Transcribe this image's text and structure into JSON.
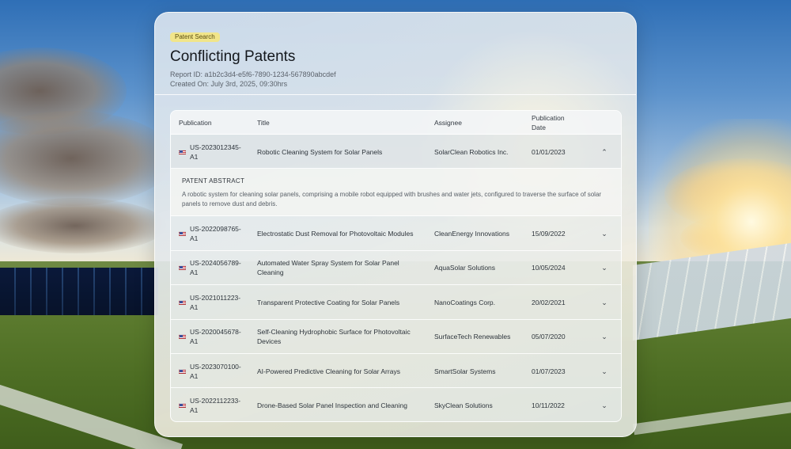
{
  "header": {
    "badge": "Patent Search",
    "title": "Conflicting Patents",
    "report_id": "Report ID: a1b2c3d4-e5f6-7890-1234-567890abcdef",
    "created_on": "Created On: July 3rd, 2025, 09:30hrs"
  },
  "table": {
    "columns": [
      "Publication",
      "Title",
      "Assignee",
      "Publication Date"
    ],
    "abstract_label": "PATENT ABSTRACT",
    "rows": [
      {
        "publication": "US-2023012345-A1",
        "title": "Robotic Cleaning System for Solar Panels",
        "assignee": "SolarClean Robotics Inc.",
        "date": "01/01/2023",
        "chevron": "⌃",
        "abstract": "A robotic system for cleaning solar panels, comprising a mobile robot equipped with brushes and water jets, configured to traverse the surface of solar panels to remove dust and debris."
      },
      {
        "publication": "US-2022098765-A1",
        "title": "Electrostatic Dust Removal for Photovoltaic Modules",
        "assignee": "CleanEnergy Innovations",
        "date": "15/09/2022",
        "chevron": "⌄"
      },
      {
        "publication": "US-2024056789-A1",
        "title": "Automated Water Spray System for Solar Panel Cleaning",
        "assignee": "AquaSolar Solutions",
        "date": "10/05/2024",
        "chevron": "⌄"
      },
      {
        "publication": "US-2021011223-A1",
        "title": "Transparent Protective Coating for Solar Panels",
        "assignee": "NanoCoatings Corp.",
        "date": "20/02/2021",
        "chevron": "⌄"
      },
      {
        "publication": "US-2020045678-A1",
        "title": "Self-Cleaning Hydrophobic Surface for Photovoltaic Devices",
        "assignee": "SurfaceTech Renewables",
        "date": "05/07/2020",
        "chevron": "⌄"
      },
      {
        "publication": "US-2023070100-A1",
        "title": "AI-Powered Predictive Cleaning for Solar Arrays",
        "assignee": "SmartSolar Systems",
        "date": "01/07/2023",
        "chevron": "⌄"
      },
      {
        "publication": "US-2022112233-A1",
        "title": "Drone-Based Solar Panel Inspection and Cleaning",
        "assignee": "SkyClean Solutions",
        "date": "10/11/2022",
        "chevron": "⌄"
      }
    ]
  }
}
